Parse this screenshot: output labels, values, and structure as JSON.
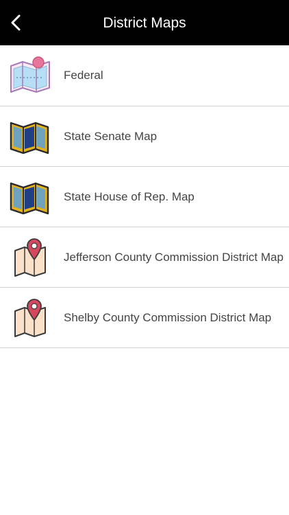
{
  "header": {
    "title": "District Maps",
    "back_icon": "chevron-left-icon"
  },
  "items": [
    {
      "label": "Federal",
      "icon": "federal-map-icon"
    },
    {
      "label": "State Senate Map",
      "icon": "folded-map-icon"
    },
    {
      "label": "State House of Rep. Map",
      "icon": "folded-map-icon"
    },
    {
      "label": "Jefferson County Commission District Map",
      "icon": "map-pin-icon"
    },
    {
      "label": "Shelby County Commission District Map",
      "icon": "map-pin-icon"
    }
  ],
  "colors": {
    "header_bg": "#000000",
    "header_text": "#ffffff",
    "label_text": "#444444",
    "divider": "#d4d4d4"
  }
}
